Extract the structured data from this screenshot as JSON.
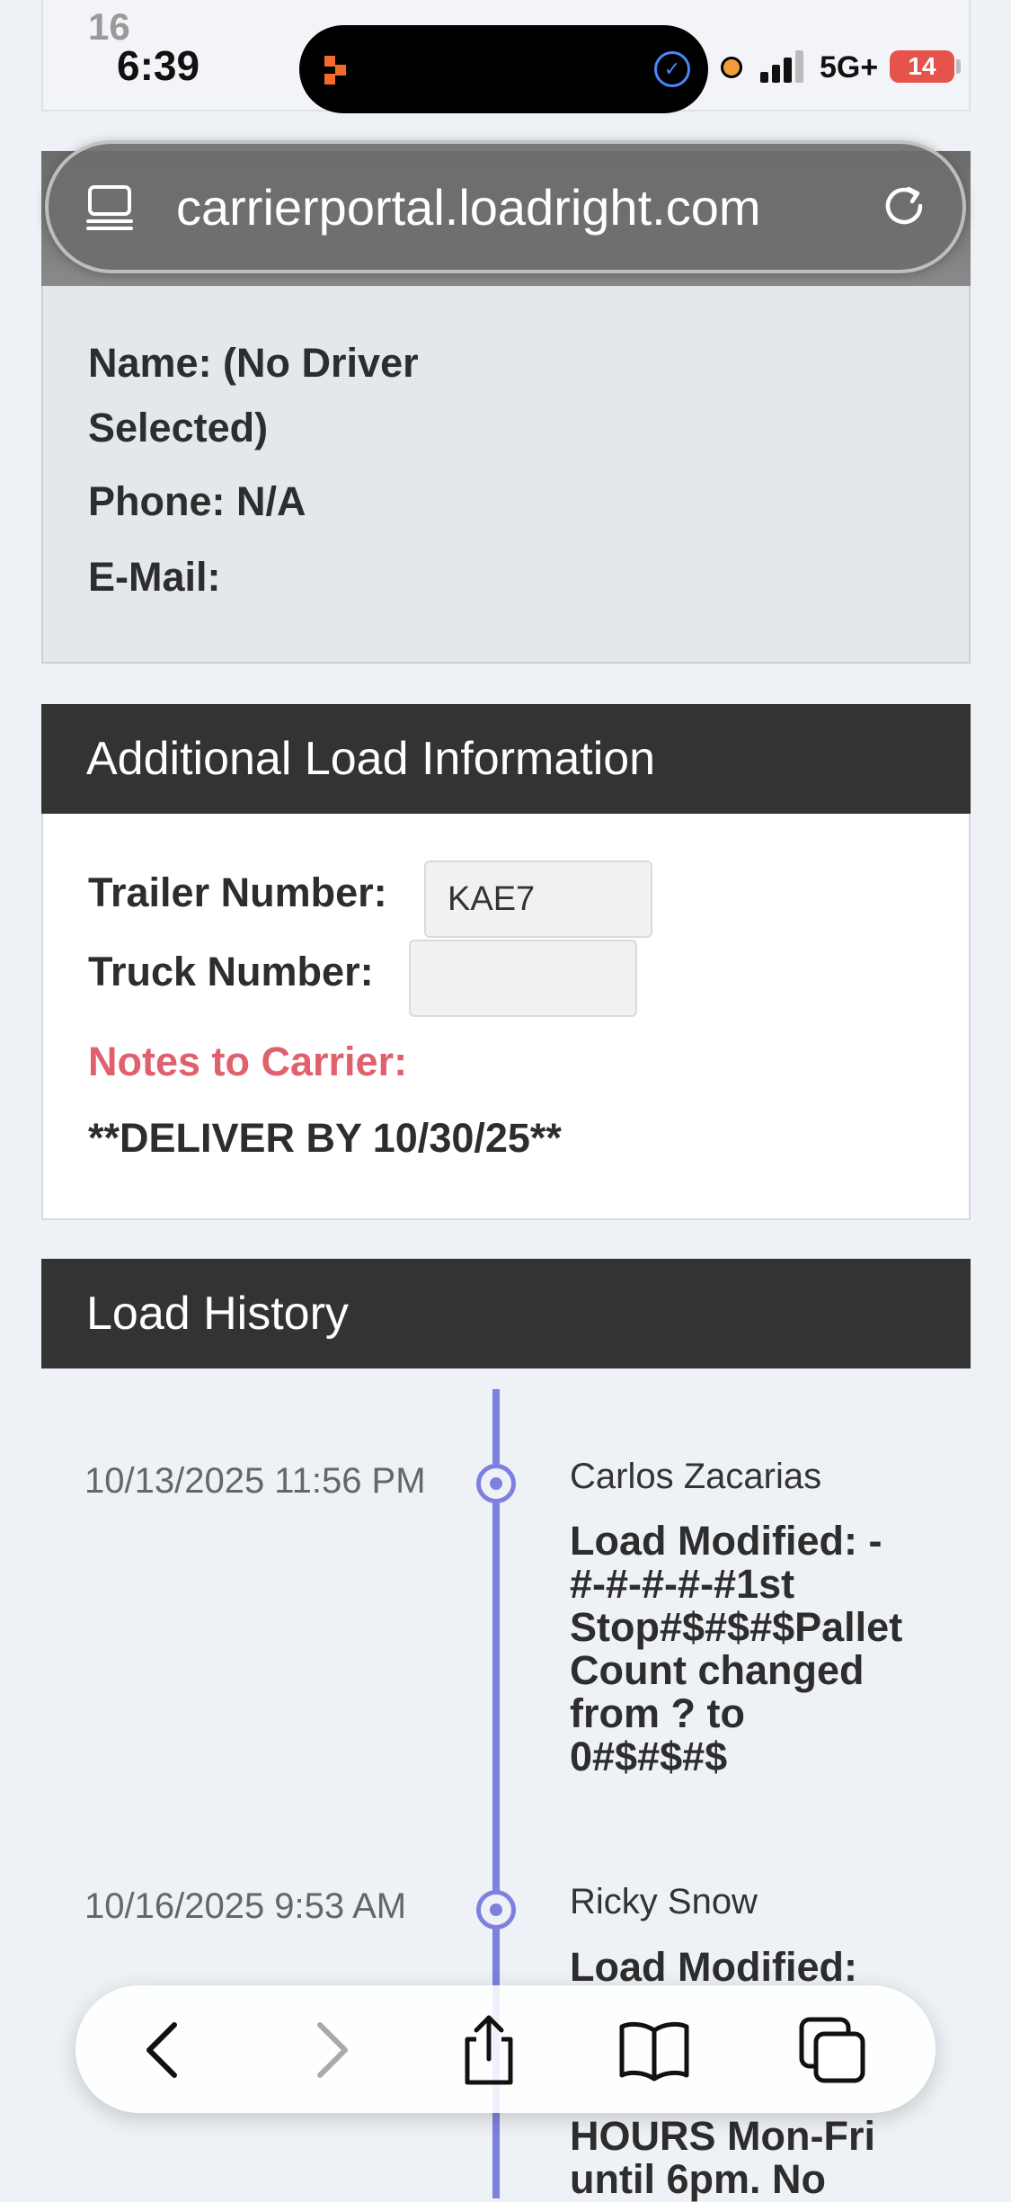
{
  "status_bar": {
    "top_number": "16",
    "time": "6:39",
    "network": "5G+",
    "battery": "14"
  },
  "browser": {
    "url": "carrierportal.loadright.com"
  },
  "driver": {
    "name_line1": "Name: (No Driver",
    "name_line2": "Selected)",
    "phone": "Phone: N/A",
    "email": "E-Mail:"
  },
  "additional_info": {
    "title": "Additional Load Information",
    "trailer_label": "Trailer Number:",
    "trailer_value": "KAE7",
    "truck_label": "Truck Number:",
    "truck_value": "",
    "notes_label": "Notes to Carrier:",
    "notes_text": "**DELIVER BY 10/30/25**"
  },
  "load_history": {
    "title": "Load History",
    "entries": [
      {
        "timestamp": "10/13/2025 11:56 PM",
        "author": "Carlos Zacarias",
        "lines": [
          "Load Modified: -",
          "#-#-#-#-#1st",
          "Stop#$#$#$Pallet",
          "Count changed",
          "from ? to",
          "0#$#$#$"
        ]
      },
      {
        "timestamp": "10/16/2025 9:53 AM",
        "author": "Ricky Snow",
        "lines": [
          "Load Modified:",
          "HOURS Mon-Fri",
          "until 6pm. No"
        ]
      }
    ]
  }
}
